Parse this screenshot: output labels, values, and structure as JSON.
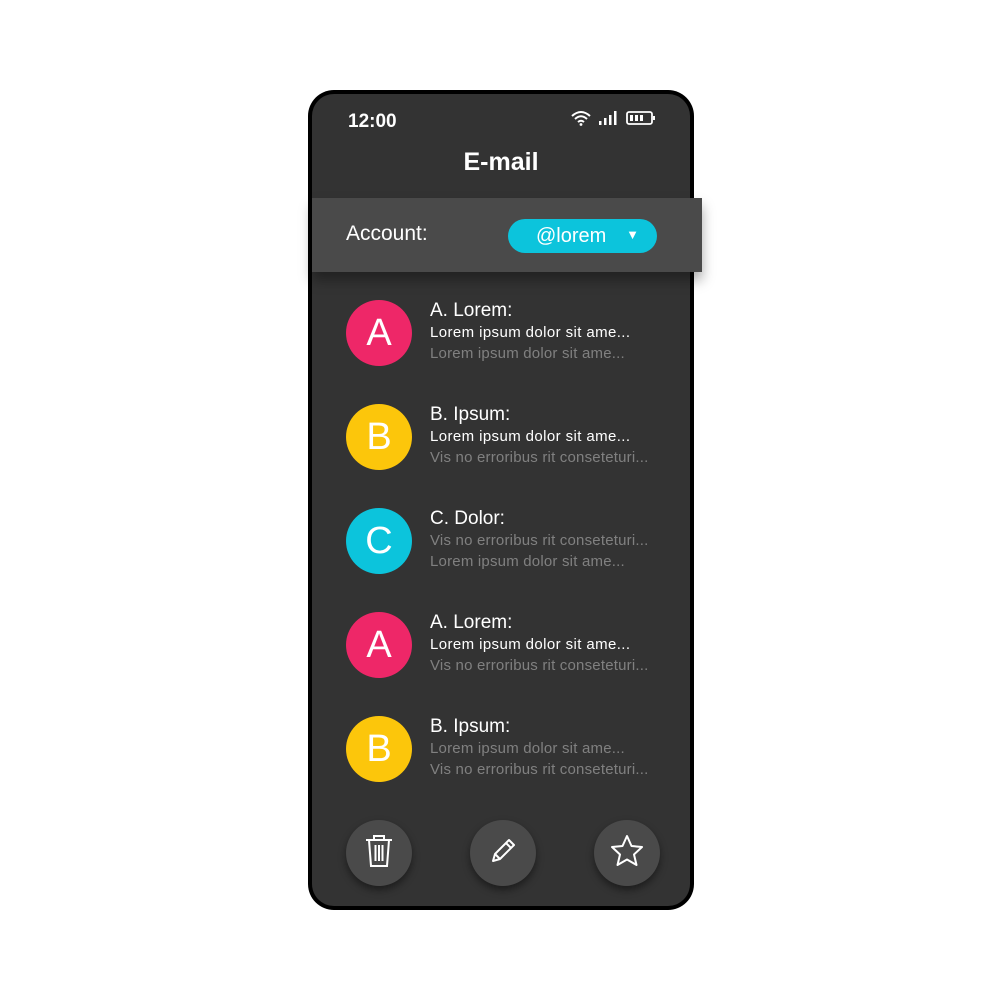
{
  "status": {
    "time": "12:00"
  },
  "app": {
    "title": "E-mail"
  },
  "account": {
    "label": "Account:",
    "selected": "@lorem"
  },
  "emails": [
    {
      "initial": "A",
      "color": "#ee2768",
      "sender": "A. Lorem:",
      "line1": "Lorem ipsum dolor sit ame...",
      "line2": "Lorem ipsum dolor sit ame...",
      "line1_style": "bright",
      "line2_style": "dim"
    },
    {
      "initial": "B",
      "color": "#fcc60b",
      "sender": "B. Ipsum:",
      "line1": "Lorem ipsum dolor sit ame...",
      "line2": "Vis no erroribus rit conseteturi...",
      "line1_style": "bright",
      "line2_style": "dim"
    },
    {
      "initial": "C",
      "color": "#0cc4dc",
      "sender": "C. Dolor:",
      "line1": "Vis no erroribus rit conseteturi...",
      "line2": "Lorem ipsum dolor sit ame...",
      "line1_style": "dim",
      "line2_style": "dim"
    },
    {
      "initial": "A",
      "color": "#ee2768",
      "sender": "A. Lorem:",
      "line1": "Lorem ipsum dolor sit ame...",
      "line2": "Vis no erroribus rit conseteturi...",
      "line1_style": "bright",
      "line2_style": "dim"
    },
    {
      "initial": "B",
      "color": "#fcc60b",
      "sender": "B. Ipsum:",
      "line1": "Lorem ipsum dolor sit ame...",
      "line2": "Vis no erroribus rit conseteturi...",
      "line1_style": "dim",
      "line2_style": "dim"
    }
  ],
  "actions": [
    {
      "icon": "trash-icon"
    },
    {
      "icon": "pencil-icon"
    },
    {
      "icon": "star-icon"
    }
  ],
  "colors": {
    "screen": "#333333",
    "bar": "#4a4a4a",
    "accent": "#0cc4dc"
  }
}
